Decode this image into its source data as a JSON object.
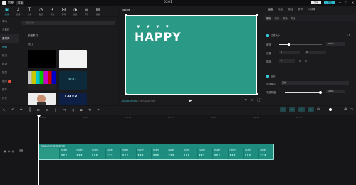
{
  "app": {
    "name": "剪映",
    "menu_label": "菜单",
    "window_title": "0201"
  },
  "titlebar": {
    "share_label": "分享",
    "export_label": "导出",
    "min": "—",
    "max": "□",
    "close": "✕"
  },
  "toolbar": {
    "items": [
      {
        "label": "媒体",
        "icon": "▣"
      },
      {
        "label": "音频",
        "icon": "♪"
      },
      {
        "label": "文本",
        "icon": "T"
      },
      {
        "label": "贴纸",
        "icon": "◔"
      },
      {
        "label": "特效",
        "icon": "✦"
      },
      {
        "label": "转场",
        "icon": "⋈"
      },
      {
        "label": "滤镜",
        "icon": "◑"
      },
      {
        "label": "调节",
        "icon": "≡"
      },
      {
        "label": "模板",
        "icon": "▤"
      }
    ]
  },
  "sidebar": {
    "items": [
      {
        "label": "本地"
      },
      {
        "label": "云素材"
      },
      {
        "label": "素材库"
      },
      {
        "label": "收藏"
      },
      {
        "label": "热门"
      },
      {
        "label": "转场"
      },
      {
        "label": "搞笑"
      },
      {
        "label": "故障"
      },
      {
        "label": "新年"
      },
      {
        "label": "片头"
      }
    ]
  },
  "media": {
    "search_placeholder": "搜索素材",
    "section1": "收藏素材",
    "section2": "热门",
    "thumb_labels": [
      "00:01",
      "00:03",
      "00:05",
      "00:10",
      "LATER..."
    ]
  },
  "player": {
    "header": "播放器",
    "overlay_text": "HAPPY",
    "hearts": "♥♥♥♥",
    "current_time": "00:00:00:00",
    "duration": "/ 00:00:20:00",
    "play_icon": "▶"
  },
  "rpanel": {
    "tabs": [
      "画面",
      "动画",
      "变速",
      "调节",
      "AI效果"
    ],
    "subtabs": [
      "基础",
      "抠像",
      "蒙版",
      "背景"
    ],
    "section1": "位置大小",
    "scale_label": "缩放",
    "scale_value": "100%",
    "position_label": "位置",
    "x_value": "0",
    "y_value": "0",
    "rotate_label": "旋转",
    "rotate_value": "0°",
    "section2": "混合",
    "mode_label": "混合模式",
    "mode_value": "正常",
    "opacity_label": "不透明度",
    "opacity_value": "100%",
    "reset_label": "↺"
  },
  "timeline": {
    "ticks": [
      "00:00",
      "00:05",
      "00:10",
      "00:15",
      "00:20",
      "00:25",
      "00:30"
    ],
    "track_name": "封面",
    "clip_label": "Happy.mp4  00:00:20:00"
  },
  "colors": {
    "accent": "#38c7d6",
    "canvas": "#2a9a87",
    "clip": "#1e8d80"
  }
}
